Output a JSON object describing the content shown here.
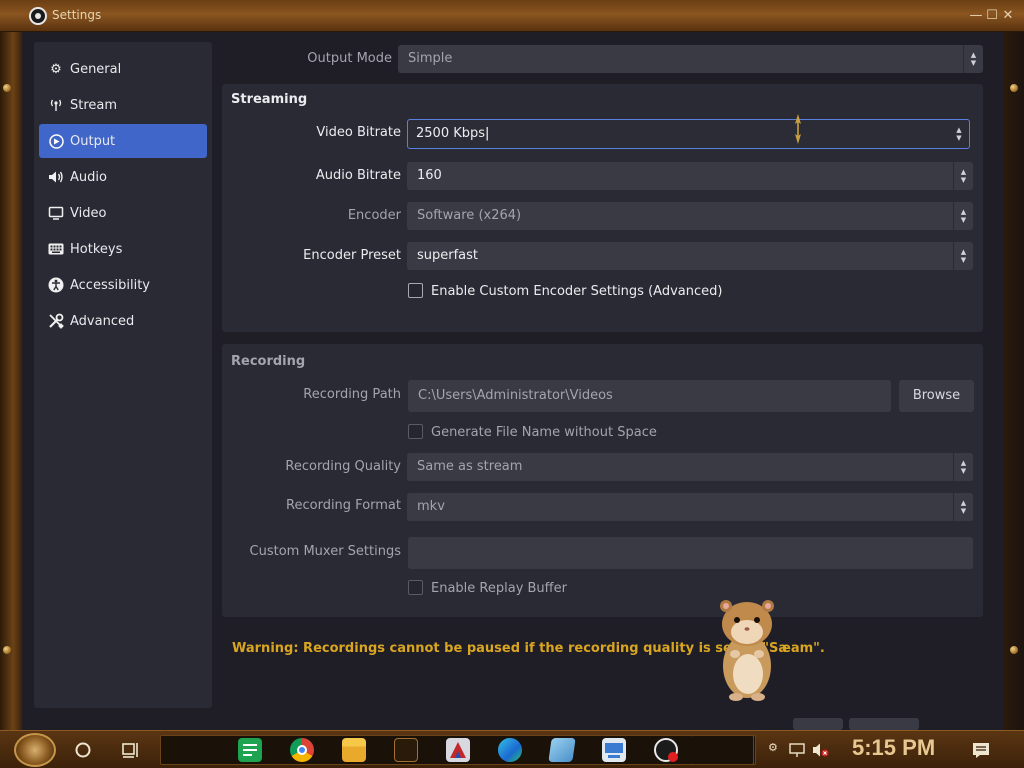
{
  "titlebar": {
    "title": "Settings",
    "minimize": "—",
    "maximize": "☐",
    "close": "✕"
  },
  "sidebar": {
    "items": [
      {
        "label": "General",
        "icon": "gear-icon",
        "active": false
      },
      {
        "label": "Stream",
        "icon": "antenna-icon",
        "active": false
      },
      {
        "label": "Output",
        "icon": "output-icon",
        "active": true
      },
      {
        "label": "Audio",
        "icon": "speaker-icon",
        "active": false
      },
      {
        "label": "Video",
        "icon": "monitor-icon",
        "active": false
      },
      {
        "label": "Hotkeys",
        "icon": "keyboard-icon",
        "active": false
      },
      {
        "label": "Accessibility",
        "icon": "accessibility-icon",
        "active": false
      },
      {
        "label": "Advanced",
        "icon": "tools-icon",
        "active": false
      }
    ]
  },
  "output_mode": {
    "label": "Output Mode",
    "value": "Simple"
  },
  "streaming": {
    "title": "Streaming",
    "video_bitrate": {
      "label": "Video Bitrate",
      "value": "2500 Kbps"
    },
    "audio_bitrate": {
      "label": "Audio Bitrate",
      "value": "160"
    },
    "encoder": {
      "label": "Encoder",
      "value": "Software (x264)"
    },
    "encoder_preset": {
      "label": "Encoder Preset",
      "value": "superfast"
    },
    "custom_encoder": {
      "label": "Enable Custom Encoder Settings (Advanced)",
      "checked": false
    }
  },
  "recording": {
    "title": "Recording",
    "path": {
      "label": "Recording Path",
      "value": "C:\\Users\\Administrator\\Videos"
    },
    "browse": "Browse",
    "no_space": {
      "label": "Generate File Name without Space",
      "checked": false
    },
    "quality": {
      "label": "Recording Quality",
      "value": "Same as stream"
    },
    "format": {
      "label": "Recording Format",
      "value": "mkv"
    },
    "muxer": {
      "label": "Custom Muxer Settings",
      "value": ""
    },
    "replay_buffer": {
      "label": "Enable Replay Buffer",
      "checked": false
    }
  },
  "warning": "Warning: Recordings cannot be paused if the recording quality is set to \"Sa",
  "warning_tail": "eam\".",
  "taskbar": {
    "clock": "5:15 PM",
    "apps": [
      "sheets-icon",
      "chrome-icon",
      "folder-icon",
      "media-icon",
      "app-icon",
      "edge-icon",
      "notepad-icon",
      "network-app-icon",
      "obs-icon"
    ]
  },
  "colors": {
    "accent": "#3f66c8",
    "warning": "#d9a521",
    "panel": "#2a2a34",
    "field": "#3a3a45"
  }
}
